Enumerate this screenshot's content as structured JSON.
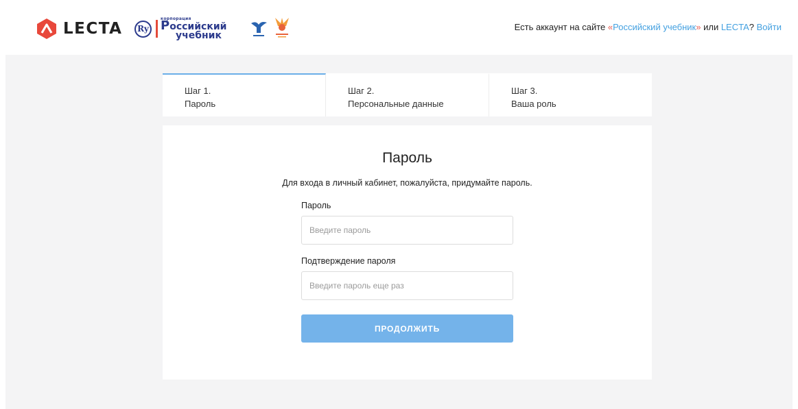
{
  "header": {
    "brand": "LECTA",
    "partner_logo": {
      "tiny": "корпорация",
      "line1": "оссийский",
      "line2": "учебник",
      "initial": "Р"
    },
    "login_prompt": {
      "prefix": "Есть аккаунт на сайте ",
      "quote_open": "«",
      "site1": "Российский учебник",
      "quote_close": "»",
      "or": " или ",
      "site2": "LECTA",
      "question": "? ",
      "login_link": "Войти"
    }
  },
  "steps": [
    {
      "number": "Шаг 1.",
      "title": "Пароль",
      "active": true
    },
    {
      "number": "Шаг 2.",
      "title": "Персональные данные",
      "active": false
    },
    {
      "number": "Шаг 3.",
      "title": "Ваша роль",
      "active": false
    }
  ],
  "form": {
    "title": "Пароль",
    "subtitle": "Для входа в личный кабинет, пожалуйста, придумайте пароль.",
    "password": {
      "label": "Пароль",
      "value": "",
      "placeholder": "Введите пароль"
    },
    "confirm": {
      "label": "Подтверждение пароля",
      "value": "",
      "placeholder": "Введите пароль еще раз"
    },
    "submit_label": "ПРОДОЛЖИТЬ"
  },
  "colors": {
    "accent": "#43a0e0",
    "button": "#74b3ea",
    "lecta_red": "#e8483b",
    "background": "#f4f4f5"
  },
  "icons": [
    "lecta-logo-icon",
    "russian-textbook-logo",
    "drofa-logo-icon",
    "ventana-graf-logo-icon"
  ]
}
